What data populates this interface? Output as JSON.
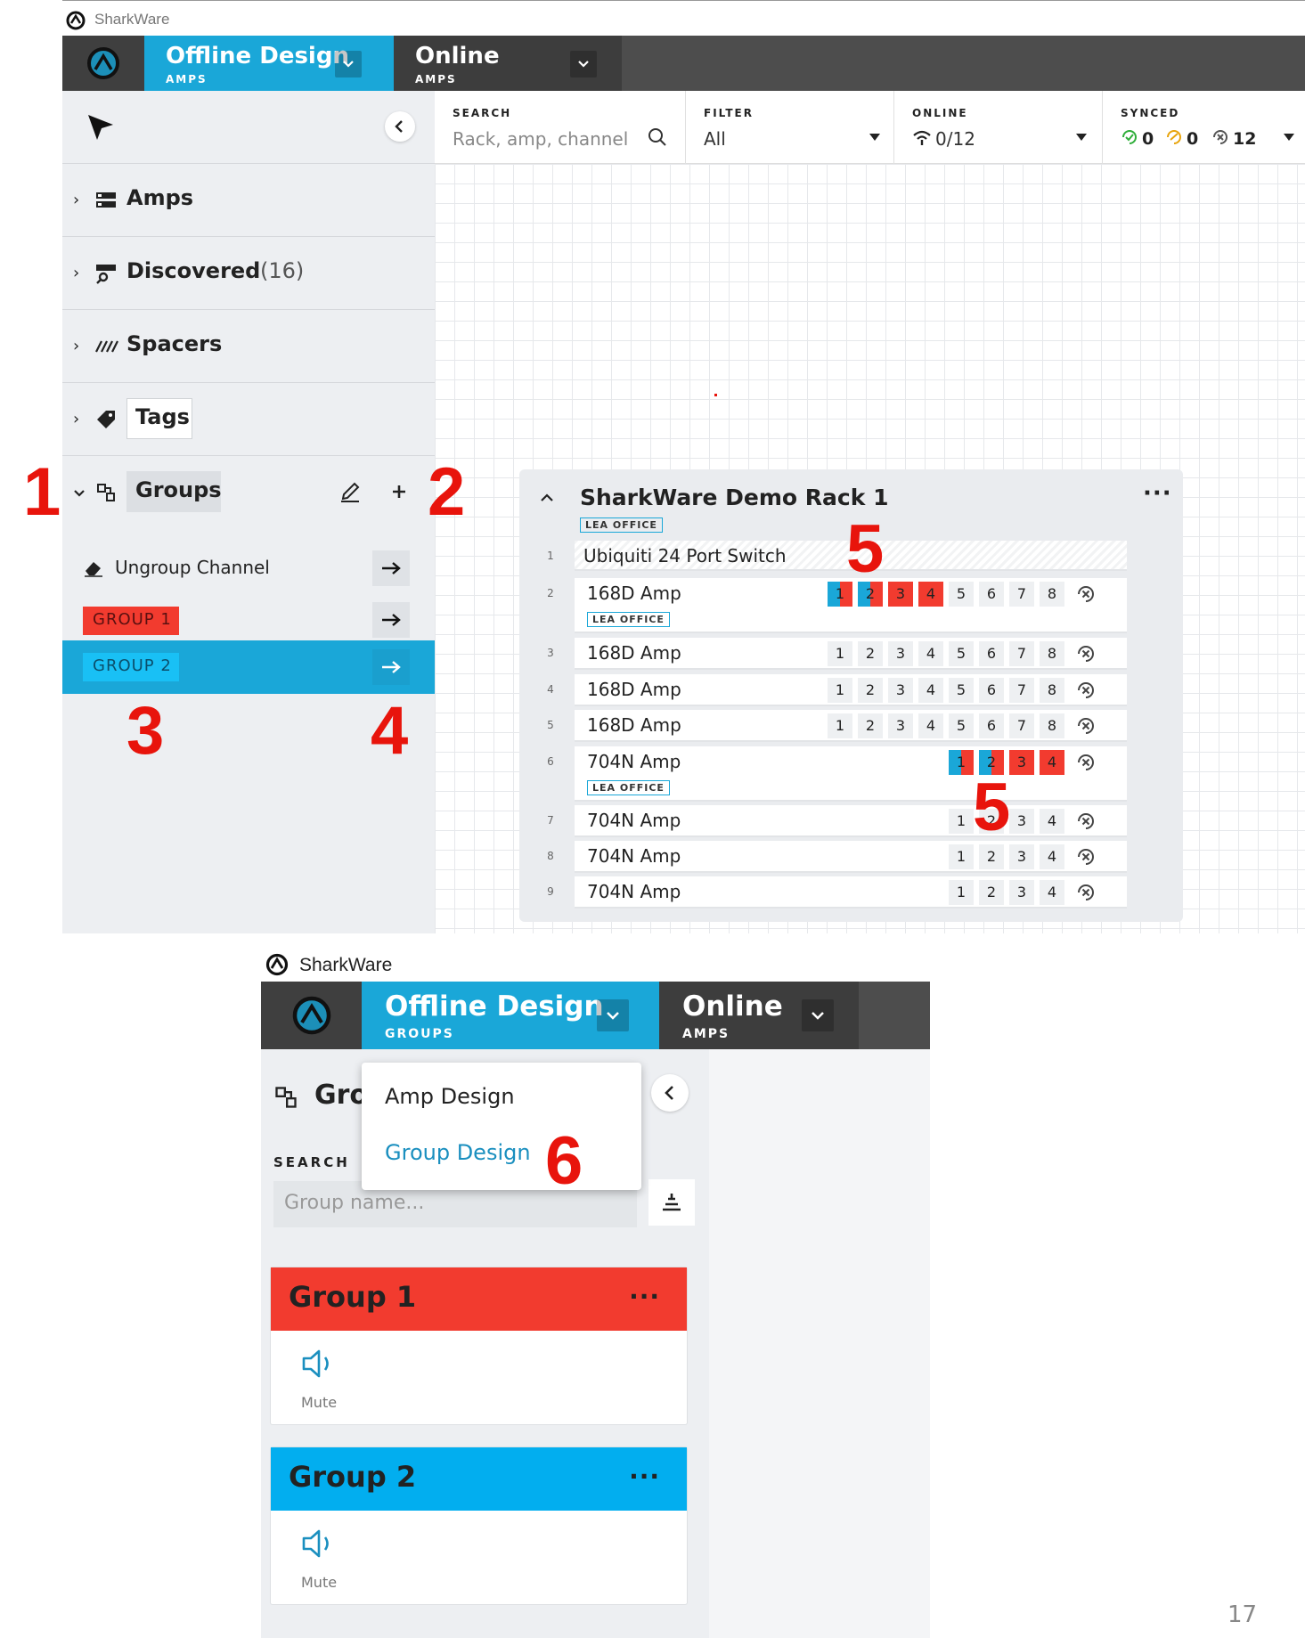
{
  "app": {
    "name": "SharkWare"
  },
  "colors": {
    "accent_blue": "#1aa7d8",
    "group1_red": "#f23b2f",
    "group2_blue": "#02aeef",
    "annotation_red": "#e8140c",
    "dark_bar": "#4d4d4d"
  },
  "top_panel": {
    "tabs": [
      {
        "title": "Offline Design",
        "sub": "AMPS",
        "active": true
      },
      {
        "title": "Online",
        "sub": "AMPS",
        "active": false
      }
    ],
    "filterbar": {
      "search": {
        "label": "SEARCH",
        "placeholder": "Rack, amp, channel"
      },
      "filter": {
        "label": "FILTER",
        "value": "All"
      },
      "online": {
        "label": "ONLINE",
        "value": "0/12"
      },
      "synced": {
        "label": "SYNCED",
        "green": "0",
        "orange": "0",
        "gray": "12"
      }
    },
    "sidebar": {
      "sections": [
        {
          "label": "Amps",
          "icon": "server-icon"
        },
        {
          "label": "Discovered",
          "count": "(16)",
          "icon": "discovered-icon"
        },
        {
          "label": "Spacers",
          "icon": "spacer-icon"
        },
        {
          "label": "Tags",
          "icon": "tag-icon"
        },
        {
          "label": "Groups",
          "icon": "groups-icon"
        }
      ],
      "group_items": [
        {
          "label": "Ungroup Channel"
        },
        {
          "label": "GROUP 1"
        },
        {
          "label": "GROUP 2"
        }
      ]
    },
    "rack": {
      "title": "SharkWare Demo Rack 1",
      "tag": "LEA OFFICE",
      "rows": [
        {
          "num": "1",
          "name": "Ubiquiti 24 Port Switch",
          "tag": "",
          "channels": []
        },
        {
          "num": "2",
          "name": "168D Amp",
          "tag": "LEA OFFICE",
          "channels": [
            "1",
            "2",
            "3",
            "4",
            "5",
            "6",
            "7",
            "8"
          ]
        },
        {
          "num": "3",
          "name": "168D Amp",
          "tag": "",
          "channels": [
            "1",
            "2",
            "3",
            "4",
            "5",
            "6",
            "7",
            "8"
          ]
        },
        {
          "num": "4",
          "name": "168D Amp",
          "tag": "",
          "channels": [
            "1",
            "2",
            "3",
            "4",
            "5",
            "6",
            "7",
            "8"
          ]
        },
        {
          "num": "5",
          "name": "168D Amp",
          "tag": "",
          "channels": [
            "1",
            "2",
            "3",
            "4",
            "5",
            "6",
            "7",
            "8"
          ]
        },
        {
          "num": "6",
          "name": "704N Amp",
          "tag": "LEA OFFICE",
          "channels": [
            "1",
            "2",
            "3",
            "4"
          ]
        },
        {
          "num": "7",
          "name": "704N Amp",
          "tag": "",
          "channels": [
            "1",
            "2",
            "3",
            "4"
          ]
        },
        {
          "num": "8",
          "name": "704N Amp",
          "tag": "",
          "channels": [
            "1",
            "2",
            "3",
            "4"
          ]
        },
        {
          "num": "9",
          "name": "704N Amp",
          "tag": "",
          "channels": [
            "1",
            "2",
            "3",
            "4"
          ]
        }
      ]
    },
    "annotations": [
      "1",
      "2",
      "3",
      "4",
      "5",
      "5"
    ]
  },
  "bottom_panel": {
    "tabs": [
      {
        "title": "Offline Design",
        "sub": "GROUPS",
        "active": true
      },
      {
        "title": "Online",
        "sub": "AMPS",
        "active": false
      }
    ],
    "heading": "Gro",
    "search": {
      "label": "SEARCH",
      "placeholder": "Group name..."
    },
    "menu": {
      "items": [
        "Amp Design",
        "Group Design"
      ]
    },
    "groups": [
      {
        "name": "Group 1",
        "action": "Mute",
        "color": "#f23b2f"
      },
      {
        "name": "Group 2",
        "action": "Mute",
        "color": "#02aeef"
      }
    ],
    "annotation": "6"
  },
  "page_number": "17"
}
